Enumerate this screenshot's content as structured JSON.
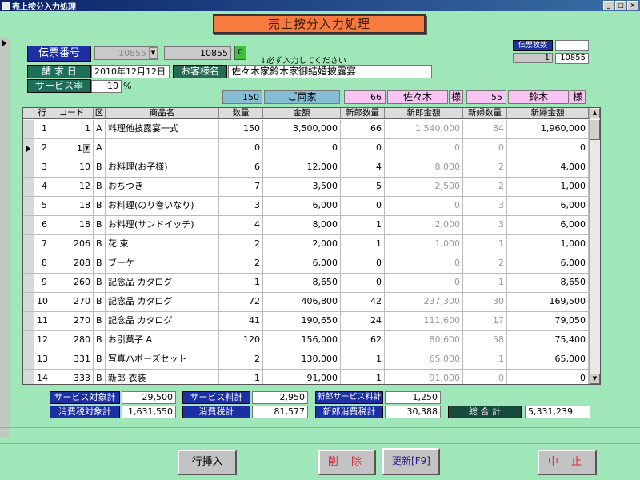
{
  "window": {
    "title": "売上按分入力処理",
    "min": "_",
    "max": "□",
    "close": "×"
  },
  "form_title": "売上按分入力処理",
  "header": {
    "slip_no_label": "伝票番号",
    "slip_no_combo": "10855",
    "slip_no_value": "10855",
    "slip_no_btn": "0",
    "note": "↓必ず入力してください",
    "slip_count_label": "伝票枚数",
    "slip_count_value": "1",
    "slip_count_top": "",
    "slip_count_no": "10855",
    "billing_date_label": "請 求 日",
    "billing_date_value": "2010年12月12日",
    "customer_label": "お客様名",
    "customer_value": "佐々木家鈴木家御結婚披露宴",
    "service_rate_label": "サービス率",
    "service_rate_value": "10",
    "service_rate_unit": "%"
  },
  "split": {
    "both_count": "150",
    "both_label": "ご両家",
    "groom_count": "66",
    "groom_name": "佐々木",
    "groom_sama": "様",
    "bride_count": "55",
    "bride_name": "鈴木",
    "bride_sama": "様"
  },
  "columns": [
    "行",
    "コード",
    "区",
    "商品名",
    "数量",
    "金額",
    "新郎数量",
    "新郎金額",
    "新婦数量",
    "新婦金額"
  ],
  "rows": [
    {
      "line": "1",
      "code": "1",
      "kbn": "A",
      "name": "料理他披露宴一式",
      "qty": "150",
      "amount": "3,500,000",
      "gqty": "66",
      "gamt": "1,540,000",
      "bqty": "84",
      "bamt": "1,960,000"
    },
    {
      "line": "2",
      "code": "1",
      "kbn": "A",
      "name": "",
      "qty": "0",
      "amount": "0",
      "gqty": "0",
      "gamt": "0",
      "bqty": "0",
      "bamt": "0"
    },
    {
      "line": "3",
      "code": "10",
      "kbn": "B",
      "name": "お料理(お子様)",
      "qty": "6",
      "amount": "12,000",
      "gqty": "4",
      "gamt": "8,000",
      "bqty": "2",
      "bamt": "4,000"
    },
    {
      "line": "4",
      "code": "12",
      "kbn": "B",
      "name": "おちつき",
      "qty": "7",
      "amount": "3,500",
      "gqty": "5",
      "gamt": "2,500",
      "bqty": "2",
      "bamt": "1,000"
    },
    {
      "line": "5",
      "code": "18",
      "kbn": "B",
      "name": "お料理(のり巻いなり)",
      "qty": "3",
      "amount": "6,000",
      "gqty": "0",
      "gamt": "0",
      "bqty": "3",
      "bamt": "6,000"
    },
    {
      "line": "6",
      "code": "18",
      "kbn": "B",
      "name": "お料理(サンドイッチ)",
      "qty": "4",
      "amount": "8,000",
      "gqty": "1",
      "gamt": "2,000",
      "bqty": "3",
      "bamt": "6,000"
    },
    {
      "line": "7",
      "code": "206",
      "kbn": "B",
      "name": "花 束",
      "qty": "2",
      "amount": "2,000",
      "gqty": "1",
      "gamt": "1,000",
      "bqty": "1",
      "bamt": "1,000"
    },
    {
      "line": "8",
      "code": "208",
      "kbn": "B",
      "name": "ブーケ",
      "qty": "2",
      "amount": "6,000",
      "gqty": "0",
      "gamt": "0",
      "bqty": "2",
      "bamt": "6,000"
    },
    {
      "line": "9",
      "code": "260",
      "kbn": "B",
      "name": "記念品 カタログ",
      "qty": "1",
      "amount": "8,650",
      "gqty": "0",
      "gamt": "0",
      "bqty": "1",
      "bamt": "8,650"
    },
    {
      "line": "10",
      "code": "270",
      "kbn": "B",
      "name": "記念品 カタログ",
      "qty": "72",
      "amount": "406,800",
      "gqty": "42",
      "gamt": "237,300",
      "bqty": "30",
      "bamt": "169,500"
    },
    {
      "line": "11",
      "code": "270",
      "kbn": "B",
      "name": "記念品 カタログ",
      "qty": "41",
      "amount": "190,650",
      "gqty": "24",
      "gamt": "111,600",
      "bqty": "17",
      "bamt": "79,050"
    },
    {
      "line": "12",
      "code": "280",
      "kbn": "B",
      "name": "お引菓子 A",
      "qty": "120",
      "amount": "156,000",
      "gqty": "62",
      "gamt": "80,600",
      "bqty": "58",
      "bamt": "75,400"
    },
    {
      "line": "13",
      "code": "331",
      "kbn": "B",
      "name": "写真ハボーズセット",
      "qty": "2",
      "amount": "130,000",
      "gqty": "1",
      "gamt": "65,000",
      "bqty": "1",
      "bamt": "65,000"
    },
    {
      "line": "14",
      "code": "333",
      "kbn": "B",
      "name": "新郎 衣装",
      "qty": "1",
      "amount": "91,000",
      "gqty": "1",
      "gamt": "91,000",
      "bqty": "0",
      "bamt": "0"
    }
  ],
  "totals": {
    "service_target_label": "サービス対象計",
    "service_target_value": "29,500",
    "service_fee_label": "サービス料計",
    "service_fee_value": "2,950",
    "groom_service_label": "新郎サービス料計",
    "groom_service_value": "1,250",
    "tax_target_label": "消費税対象計",
    "tax_target_value": "1,631,550",
    "tax_label": "消費税計",
    "tax_value": "81,577",
    "groom_tax_label": "新郎消費税計",
    "groom_tax_value": "30,388",
    "grand_total_label": "総 合 計",
    "grand_total_value": "5,331,239"
  },
  "buttons": {
    "insert_row": "行挿入",
    "delete": "削 除",
    "update": "更新[F9]",
    "cancel": "中 止"
  }
}
